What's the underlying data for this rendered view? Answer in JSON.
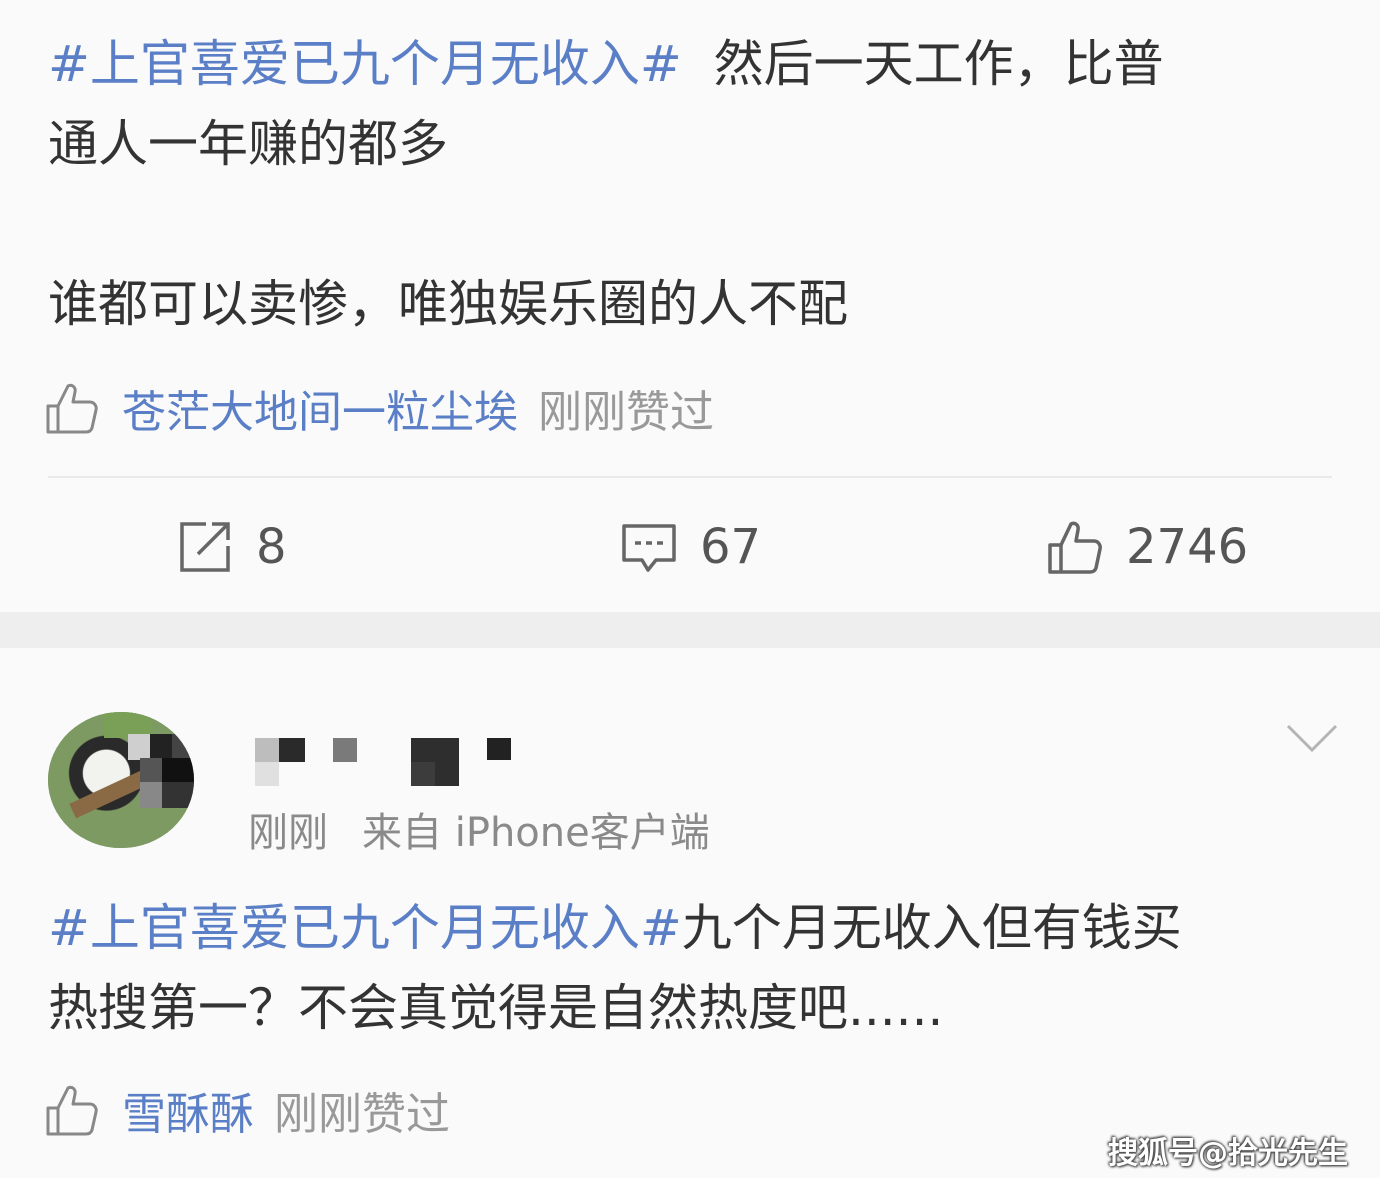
{
  "post1": {
    "topic": "#上官喜爱已九个月无收入#",
    "text_line1_rest": "  然后一天工作，比普",
    "text_line2": "通人一年赚的都多",
    "text_line3": "谁都可以卖惨，唯独娱乐圈的人不配",
    "like_user": "苍茫大地间一粒尘埃",
    "like_suffix": "刚刚赞过",
    "actions": {
      "repost_count": "8",
      "comment_count": "67",
      "like_count": "2746"
    }
  },
  "post2": {
    "time": "刚刚",
    "source": "来自 iPhone客户端",
    "topic": "#上官喜爱已九个月无收入#",
    "text_line1_rest": "九个月无收入但有钱买",
    "text_line2": "热搜第一？不会真觉得是自然热度吧......",
    "like_user": "雪酥酥",
    "like_suffix": "刚刚赞过"
  },
  "watermark": "搜狐号@拾光先生",
  "icons": {
    "like": "thumbs-up-icon",
    "repost": "repost-icon",
    "comment": "comment-icon",
    "dropdown": "chevron-down-icon"
  },
  "colors": {
    "topic": "#5b7fc7",
    "text": "#333333",
    "muted": "#999999",
    "separator": "#eeeeee"
  }
}
